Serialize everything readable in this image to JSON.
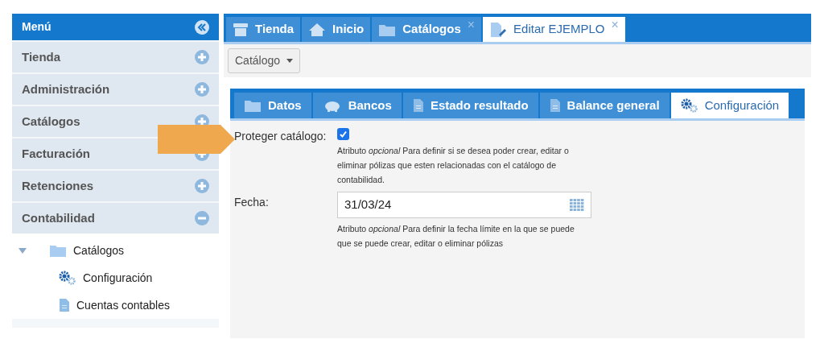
{
  "sidebar": {
    "title": "Menú",
    "items": [
      {
        "label": "Tienda",
        "expanded": false
      },
      {
        "label": "Administración",
        "expanded": false
      },
      {
        "label": "Catálogos",
        "expanded": false
      },
      {
        "label": "Facturación",
        "expanded": false
      },
      {
        "label": "Retenciones",
        "expanded": false
      },
      {
        "label": "Contabilidad",
        "expanded": true,
        "children": [
          {
            "label": "Catálogos",
            "kind": "folder",
            "expanded": true,
            "children": [
              {
                "label": "Configuración",
                "kind": "gear"
              },
              {
                "label": "Cuentas contables",
                "kind": "file"
              }
            ]
          }
        ]
      }
    ]
  },
  "tabs": [
    {
      "label": "Tienda",
      "closable": false,
      "selected": false
    },
    {
      "label": "Inicio",
      "closable": false,
      "selected": false
    },
    {
      "label": "Catálogos",
      "closable": true,
      "selected": false
    },
    {
      "label": "Editar EJEMPLO",
      "closable": true,
      "selected": true
    }
  ],
  "close_glyph": "×",
  "menu_button": "Catálogo",
  "inner_tabs": [
    {
      "label": "Datos",
      "selected": false
    },
    {
      "label": "Bancos",
      "selected": false
    },
    {
      "label": "Estado resultado",
      "selected": false
    },
    {
      "label": "Balance general",
      "selected": false
    },
    {
      "label": "Configuración",
      "selected": true
    }
  ],
  "form": [
    {
      "kind": "checkbox",
      "label": "Proteger catálogo:",
      "checked": true,
      "help": "Atributo *opcional* Para definir si se desea poder crear, editar o eliminar pólizas que esten relacionadas con el catálogo de contabilidad."
    },
    {
      "kind": "date",
      "label": "Fecha:",
      "value": "31/03/24",
      "help": "Atributo *opcional* Para definir la fecha límite en la que se puede que se puede crear, editar o eliminar pólizas"
    }
  ]
}
